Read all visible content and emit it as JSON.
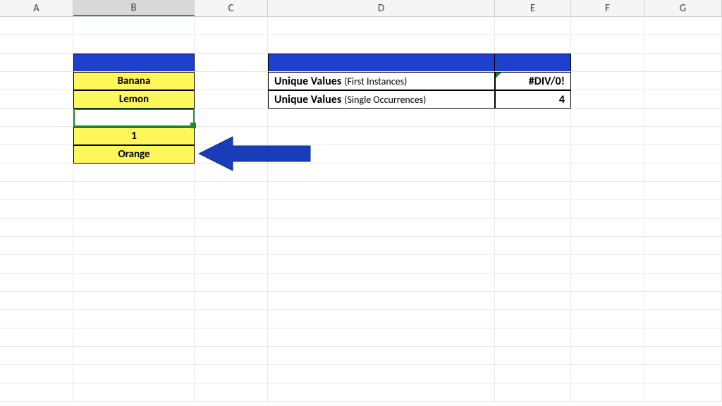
{
  "columns": {
    "A": "A",
    "B": "B",
    "C": "C",
    "D": "D",
    "E": "E",
    "F": "F",
    "G": "G"
  },
  "list": {
    "items": [
      "Banana",
      "Lemon",
      "",
      "1",
      "Orange"
    ]
  },
  "summary": {
    "row1_label": "Unique Values",
    "row1_sub": "(First Instances)",
    "row1_value": "#DIV/0!",
    "row2_label": "Unique Values",
    "row2_sub": "(Single Occurrences)",
    "row2_value": "4"
  },
  "colors": {
    "header_blue": "#1f3fcf",
    "yellow": "#fff65c",
    "arrow_blue": "#193db8"
  }
}
